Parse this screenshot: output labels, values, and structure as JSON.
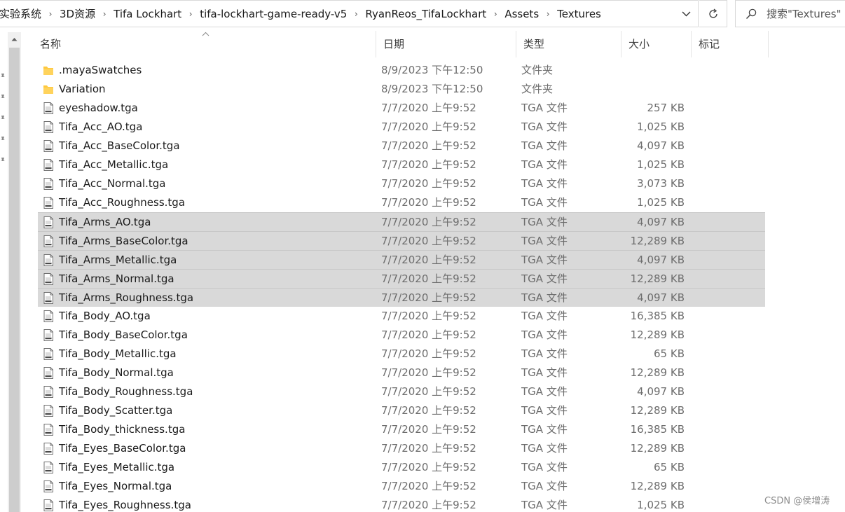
{
  "breadcrumb": [
    "实验系统",
    "3D资源",
    "Tifa Lockhart",
    "tifa-lockhart-game-ready-v5",
    "RyanReos_TifaLockhart",
    "Assets",
    "Textures"
  ],
  "search": {
    "placeholder": "搜索\"Textures\""
  },
  "columns": {
    "name": "名称",
    "date": "日期",
    "type": "类型",
    "size": "大小",
    "tags": "标记"
  },
  "files": [
    {
      "name": ".mayaSwatches",
      "date": "8/9/2023 下午12:50",
      "type": "文件夹",
      "size": "",
      "kind": "folder",
      "selected": false
    },
    {
      "name": "Variation",
      "date": "8/9/2023 下午12:50",
      "type": "文件夹",
      "size": "",
      "kind": "folder",
      "selected": false
    },
    {
      "name": "eyeshadow.tga",
      "date": "7/7/2020 上午9:52",
      "type": "TGA 文件",
      "size": "257 KB",
      "kind": "tga",
      "selected": false
    },
    {
      "name": "Tifa_Acc_AO.tga",
      "date": "7/7/2020 上午9:52",
      "type": "TGA 文件",
      "size": "1,025 KB",
      "kind": "tga",
      "selected": false
    },
    {
      "name": "Tifa_Acc_BaseColor.tga",
      "date": "7/7/2020 上午9:52",
      "type": "TGA 文件",
      "size": "4,097 KB",
      "kind": "tga",
      "selected": false
    },
    {
      "name": "Tifa_Acc_Metallic.tga",
      "date": "7/7/2020 上午9:52",
      "type": "TGA 文件",
      "size": "1,025 KB",
      "kind": "tga",
      "selected": false
    },
    {
      "name": "Tifa_Acc_Normal.tga",
      "date": "7/7/2020 上午9:52",
      "type": "TGA 文件",
      "size": "3,073 KB",
      "kind": "tga",
      "selected": false
    },
    {
      "name": "Tifa_Acc_Roughness.tga",
      "date": "7/7/2020 上午9:52",
      "type": "TGA 文件",
      "size": "1,025 KB",
      "kind": "tga",
      "selected": false
    },
    {
      "name": "Tifa_Arms_AO.tga",
      "date": "7/7/2020 上午9:52",
      "type": "TGA 文件",
      "size": "4,097 KB",
      "kind": "tga",
      "selected": true
    },
    {
      "name": "Tifa_Arms_BaseColor.tga",
      "date": "7/7/2020 上午9:52",
      "type": "TGA 文件",
      "size": "12,289 KB",
      "kind": "tga",
      "selected": true
    },
    {
      "name": "Tifa_Arms_Metallic.tga",
      "date": "7/7/2020 上午9:52",
      "type": "TGA 文件",
      "size": "4,097 KB",
      "kind": "tga",
      "selected": true
    },
    {
      "name": "Tifa_Arms_Normal.tga",
      "date": "7/7/2020 上午9:52",
      "type": "TGA 文件",
      "size": "12,289 KB",
      "kind": "tga",
      "selected": true
    },
    {
      "name": "Tifa_Arms_Roughness.tga",
      "date": "7/7/2020 上午9:52",
      "type": "TGA 文件",
      "size": "4,097 KB",
      "kind": "tga",
      "selected": true
    },
    {
      "name": "Tifa_Body_AO.tga",
      "date": "7/7/2020 上午9:52",
      "type": "TGA 文件",
      "size": "16,385 KB",
      "kind": "tga",
      "selected": false
    },
    {
      "name": "Tifa_Body_BaseColor.tga",
      "date": "7/7/2020 上午9:52",
      "type": "TGA 文件",
      "size": "12,289 KB",
      "kind": "tga",
      "selected": false
    },
    {
      "name": "Tifa_Body_Metallic.tga",
      "date": "7/7/2020 上午9:52",
      "type": "TGA 文件",
      "size": "65 KB",
      "kind": "tga",
      "selected": false
    },
    {
      "name": "Tifa_Body_Normal.tga",
      "date": "7/7/2020 上午9:52",
      "type": "TGA 文件",
      "size": "12,289 KB",
      "kind": "tga",
      "selected": false
    },
    {
      "name": "Tifa_Body_Roughness.tga",
      "date": "7/7/2020 上午9:52",
      "type": "TGA 文件",
      "size": "4,097 KB",
      "kind": "tga",
      "selected": false
    },
    {
      "name": "Tifa_Body_Scatter.tga",
      "date": "7/7/2020 上午9:52",
      "type": "TGA 文件",
      "size": "12,289 KB",
      "kind": "tga",
      "selected": false
    },
    {
      "name": "Tifa_Body_thickness.tga",
      "date": "7/7/2020 上午9:52",
      "type": "TGA 文件",
      "size": "16,385 KB",
      "kind": "tga",
      "selected": false
    },
    {
      "name": "Tifa_Eyes_BaseColor.tga",
      "date": "7/7/2020 上午9:52",
      "type": "TGA 文件",
      "size": "12,289 KB",
      "kind": "tga",
      "selected": false
    },
    {
      "name": "Tifa_Eyes_Metallic.tga",
      "date": "7/7/2020 上午9:52",
      "type": "TGA 文件",
      "size": "65 KB",
      "kind": "tga",
      "selected": false
    },
    {
      "name": "Tifa_Eyes_Normal.tga",
      "date": "7/7/2020 上午9:52",
      "type": "TGA 文件",
      "size": "12,289 KB",
      "kind": "tga",
      "selected": false
    },
    {
      "name": "Tifa_Eyes_Roughness.tga",
      "date": "7/7/2020 上午9:52",
      "type": "TGA 文件",
      "size": "1,025 KB",
      "kind": "tga",
      "selected": false
    }
  ],
  "icons": {
    "folder": "folder-icon",
    "tga": "tga-file-icon",
    "refresh": "refresh-icon",
    "search": "search-icon",
    "dropdown": "chevron-down-icon",
    "sort": "sort-up-icon",
    "pin": "pin-icon"
  },
  "colors": {
    "selected_row": "#d9d9d9",
    "folder": "#ffc83d",
    "secondary_text": "#6d6d6d"
  },
  "watermark": "CSDN @侯增涛"
}
